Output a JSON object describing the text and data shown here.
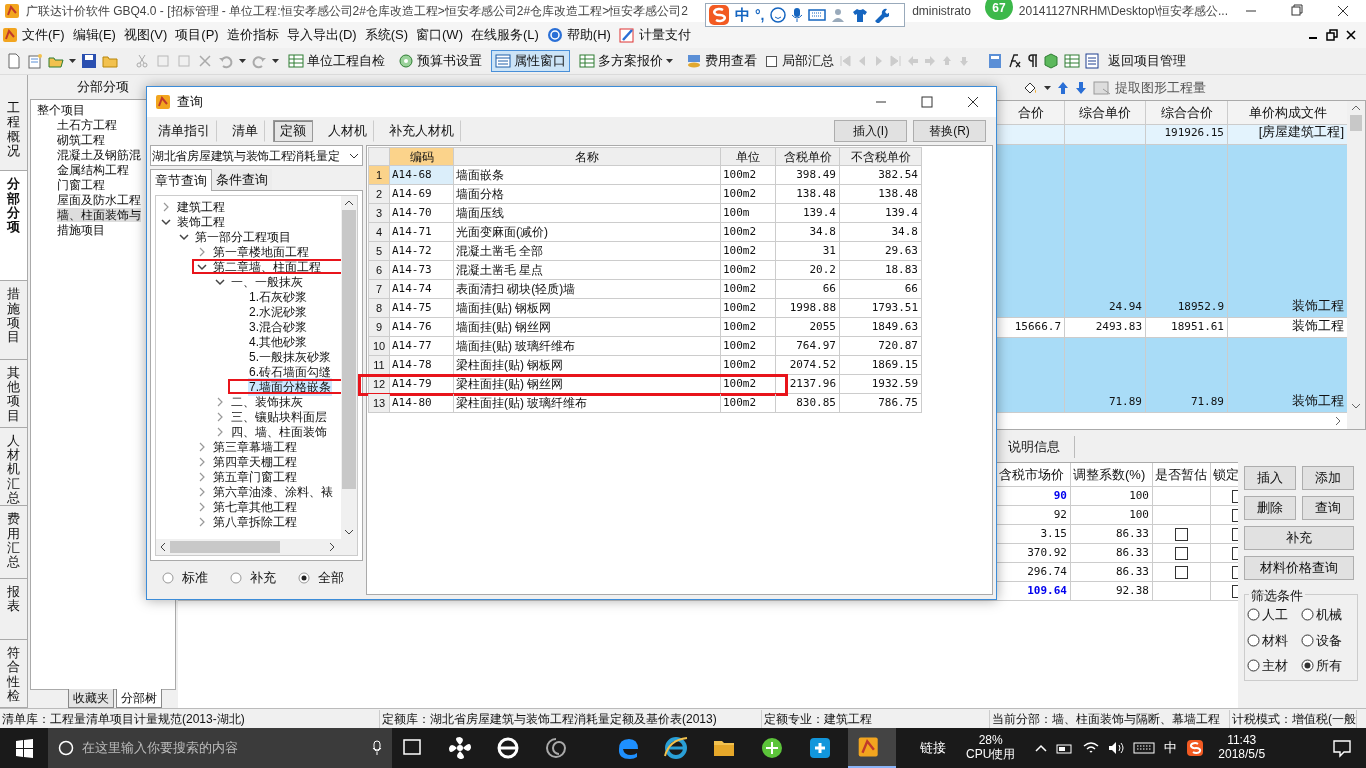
{
  "title_bar": {
    "title": "广联达计价软件 GBQ4.0 - [招标管理 - 单位工程:恒安孝感公司2#仓库改造工程>恒安孝感公司2#仓库改造工程>恒安孝感公司2",
    "user_fragment": "dministrato",
    "path_fragment": "20141127NRHM\\Desktop\\恒安孝感公...",
    "badge": "67"
  },
  "ime_bar": {
    "mode": "中",
    "punctuation": "°,"
  },
  "menu": [
    "文件(F)",
    "编辑(E)",
    "视图(V)",
    "项目(P)",
    "造价指标",
    "导入导出(D)",
    "系统(S)",
    "窗口(W)",
    "在线服务(L)",
    "帮助(H)",
    "计量支付"
  ],
  "toolbar": [
    {
      "kind": "button",
      "label": "单位工程自检"
    },
    {
      "kind": "button",
      "label": "预算书设置"
    },
    {
      "kind": "toggle",
      "label": "属性窗口",
      "selected": true
    },
    {
      "kind": "dropdown",
      "label": "多方案报价"
    },
    {
      "kind": "button",
      "label": "费用查看"
    },
    {
      "kind": "checkbox",
      "label": "局部汇总",
      "checked": false
    },
    {
      "kind": "button",
      "label": "返回项目管理"
    }
  ],
  "sub_toolbar": {
    "extract_button": "提取图形工程量"
  },
  "vertical_tabs": [
    {
      "label": "工程概况",
      "selected": false
    },
    {
      "label": "分部分项",
      "selected": true
    },
    {
      "label": "措施项目",
      "selected": false
    },
    {
      "label": "其他项目",
      "selected": false
    },
    {
      "label": "人材机汇总",
      "selected": false
    },
    {
      "label": "费用汇总",
      "selected": false
    },
    {
      "label": "报表",
      "selected": false
    },
    {
      "label": "符合性检",
      "selected": false
    }
  ],
  "left_panel": {
    "title": "分部分项",
    "tree": [
      {
        "label": "整个项目",
        "selected": false,
        "children": [
          {
            "label": "土石方工程",
            "selected": false
          },
          {
            "label": "砌筑工程",
            "selected": false
          },
          {
            "label": "混凝土及钢筋混",
            "selected": false
          },
          {
            "label": "金属结构工程",
            "selected": false
          },
          {
            "label": "门窗工程",
            "selected": false
          },
          {
            "label": "屋面及防水工程",
            "selected": false
          },
          {
            "label": "墙、柱面装饰与",
            "selected": true
          },
          {
            "label": "措施项目",
            "selected": false
          }
        ]
      }
    ],
    "bottom_tabs": [
      {
        "label": "收藏夹",
        "selected": false
      },
      {
        "label": "分部树",
        "selected": true
      }
    ]
  },
  "main_grid": {
    "columns": [
      "合价",
      "综合单价",
      "综合合价",
      "单价构成文件"
    ],
    "rows": [
      {
        "kind": "total",
        "cells": [
          "",
          "",
          "191926.15",
          "[房屋建筑工程]"
        ]
      },
      {
        "kind": "group",
        "cells": [
          "",
          "24.94",
          "18952.9",
          "装饰工程"
        ]
      },
      {
        "kind": "item",
        "cells": [
          "15666.7",
          "2493.83",
          "18951.61",
          "装饰工程"
        ]
      },
      {
        "kind": "group",
        "cells": [
          "",
          "71.89",
          "71.89",
          "装饰工程"
        ]
      }
    ]
  },
  "detail": {
    "tab": "说明信息",
    "columns": [
      "含税市场价",
      "调整系数(%)",
      "是否暂估",
      "锁定"
    ],
    "rows": [
      {
        "price": "90",
        "emphasized": true,
        "factor": "100",
        "locked": false
      },
      {
        "price": "92",
        "emphasized": false,
        "factor": "100",
        "locked": false
      },
      {
        "price": "3.15",
        "emphasized": false,
        "factor": "86.33",
        "provisional": false,
        "locked": false
      },
      {
        "price": "370.92",
        "emphasized": false,
        "factor": "86.33",
        "provisional": false,
        "locked": false
      },
      {
        "price": "296.74",
        "emphasized": false,
        "factor": "86.33",
        "provisional": false,
        "locked": false
      },
      {
        "price": "109.64",
        "emphasized": true,
        "factor": "92.38",
        "locked": false
      }
    ],
    "buttons": [
      "插入",
      "添加",
      "删除",
      "查询",
      "补充",
      "材料价格查询"
    ],
    "filter": {
      "title": "筛选条件",
      "options": [
        {
          "label": "人工",
          "selected": false
        },
        {
          "label": "机械",
          "selected": false
        },
        {
          "label": "材料",
          "selected": false
        },
        {
          "label": "设备",
          "selected": false
        },
        {
          "label": "主材",
          "selected": false
        },
        {
          "label": "所有",
          "selected": true
        }
      ]
    }
  },
  "dialog": {
    "title": "查询",
    "tabs": [
      {
        "label": "清单指引",
        "selected": false
      },
      {
        "label": "清单",
        "selected": false
      },
      {
        "label": "定额",
        "selected": true
      },
      {
        "label": "人材机",
        "selected": false
      },
      {
        "label": "补充人材机",
        "selected": false
      }
    ],
    "buttons": [
      "插入(I)",
      "替换(R)"
    ],
    "library": "湖北省房屋建筑与装饰工程消耗量定",
    "search_tabs": [
      {
        "label": "章节查询",
        "selected": true
      },
      {
        "label": "条件查询",
        "selected": false
      }
    ],
    "tree": [
      {
        "label": "建筑工程",
        "expanded": false,
        "selected": false
      },
      {
        "label": "装饰工程",
        "expanded": true,
        "selected": false,
        "children": [
          {
            "label": "第一部分工程项目",
            "expanded": true,
            "selected": false,
            "children": [
              {
                "label": "第一章楼地面工程",
                "expanded": false,
                "selected": false
              },
              {
                "label": "第二章墙、柱面工程",
                "expanded": true,
                "selected": false,
                "marked": true,
                "children": [
                  {
                    "label": "一、一般抹灰",
                    "expanded": true,
                    "selected": false,
                    "children": [
                      {
                        "label": "1.石灰砂浆",
                        "selected": false
                      },
                      {
                        "label": "2.水泥砂浆",
                        "selected": false
                      },
                      {
                        "label": "3.混合砂浆",
                        "selected": false
                      },
                      {
                        "label": "4.其他砂浆",
                        "selected": false
                      },
                      {
                        "label": "5.一般抹灰砂浆",
                        "selected": false
                      },
                      {
                        "label": "6.砖石墙面勾缝",
                        "selected": false
                      },
                      {
                        "label": "7.墙面分格嵌条",
                        "selected": true,
                        "marked": true
                      }
                    ]
                  },
                  {
                    "label": "二、装饰抹灰",
                    "expanded": false,
                    "selected": false
                  },
                  {
                    "label": "三、镶贴块料面层",
                    "expanded": false,
                    "selected": false
                  },
                  {
                    "label": "四、墙、柱面装饰",
                    "expanded": false,
                    "selected": false
                  }
                ]
              },
              {
                "label": "第三章幕墙工程",
                "expanded": false,
                "selected": false
              },
              {
                "label": "第四章天棚工程",
                "expanded": false,
                "selected": false
              },
              {
                "label": "第五章门窗工程",
                "expanded": false,
                "selected": false
              },
              {
                "label": "第六章油漆、涂料、裱",
                "expanded": false,
                "selected": false
              },
              {
                "label": "第七章其他工程",
                "expanded": false,
                "selected": false
              },
              {
                "label": "第八章拆除工程",
                "expanded": false,
                "selected": false
              }
            ]
          }
        ]
      }
    ],
    "scope": [
      {
        "label": "标准",
        "selected": false
      },
      {
        "label": "补充",
        "selected": false
      },
      {
        "label": "全部",
        "selected": true
      }
    ],
    "table": {
      "columns": [
        "编码",
        "名称",
        "单位",
        "含税单价",
        "不含税单价"
      ],
      "rows": [
        {
          "index": "1",
          "selected": true,
          "marked": false,
          "cells": [
            "A14-68",
            "墙面嵌条",
            "100m2",
            "398.49",
            "382.54"
          ]
        },
        {
          "index": "2",
          "selected": false,
          "marked": false,
          "cells": [
            "A14-69",
            "墙面分格",
            "100m2",
            "138.48",
            "138.48"
          ]
        },
        {
          "index": "3",
          "selected": false,
          "marked": false,
          "cells": [
            "A14-70",
            "墙面压线",
            "100m",
            "139.4",
            "139.4"
          ]
        },
        {
          "index": "4",
          "selected": false,
          "marked": false,
          "cells": [
            "A14-71",
            "光面变麻面(减价)",
            "100m2",
            "34.8",
            "34.8"
          ]
        },
        {
          "index": "5",
          "selected": false,
          "marked": false,
          "cells": [
            "A14-72",
            "混凝土凿毛 全部",
            "100m2",
            "31",
            "29.63"
          ]
        },
        {
          "index": "6",
          "selected": false,
          "marked": false,
          "cells": [
            "A14-73",
            "混凝土凿毛 星点",
            "100m2",
            "20.2",
            "18.83"
          ]
        },
        {
          "index": "7",
          "selected": false,
          "marked": false,
          "cells": [
            "A14-74",
            "表面清扫 砌块(轻质)墙",
            "100m2",
            "66",
            "66"
          ]
        },
        {
          "index": "8",
          "selected": false,
          "marked": false,
          "cells": [
            "A14-75",
            "墙面挂(贴) 钢板网",
            "100m2",
            "1998.88",
            "1793.51"
          ]
        },
        {
          "index": "9",
          "selected": false,
          "marked": false,
          "cells": [
            "A14-76",
            "墙面挂(贴) 钢丝网",
            "100m2",
            "2055",
            "1849.63"
          ]
        },
        {
          "index": "10",
          "selected": false,
          "marked": false,
          "cells": [
            "A14-77",
            "墙面挂(贴) 玻璃纤维布",
            "100m2",
            "764.97",
            "720.87"
          ]
        },
        {
          "index": "11",
          "selected": false,
          "marked": false,
          "cells": [
            "A14-78",
            "梁柱面挂(贴) 钢板网",
            "100m2",
            "2074.52",
            "1869.15"
          ]
        },
        {
          "index": "12",
          "selected": false,
          "marked": true,
          "cells": [
            "A14-79",
            "梁柱面挂(贴) 钢丝网",
            "100m2",
            "2137.96",
            "1932.59"
          ]
        },
        {
          "index": "13",
          "selected": false,
          "marked": false,
          "cells": [
            "A14-80",
            "梁柱面挂(贴) 玻璃纤维布",
            "100m2",
            "830.85",
            "786.75"
          ]
        }
      ]
    }
  },
  "status_bar": [
    "清单库：工程量清单项目计量规范(2013-湖北)",
    "定额库：湖北省房屋建筑与装饰工程消耗量定额及基价表(2013)",
    "定额专业：建筑工程",
    "当前分部：墙、柱面装饰与隔断、幕墙工程",
    "计税模式：增值税(一般"
  ],
  "taskbar": {
    "search_placeholder": "在这里输入你要搜索的内容",
    "links": "链接",
    "cpu_percent": "28%",
    "cpu_label": "CPU使用",
    "ime": "中",
    "time": "11:43",
    "date": "2018/5/5"
  }
}
